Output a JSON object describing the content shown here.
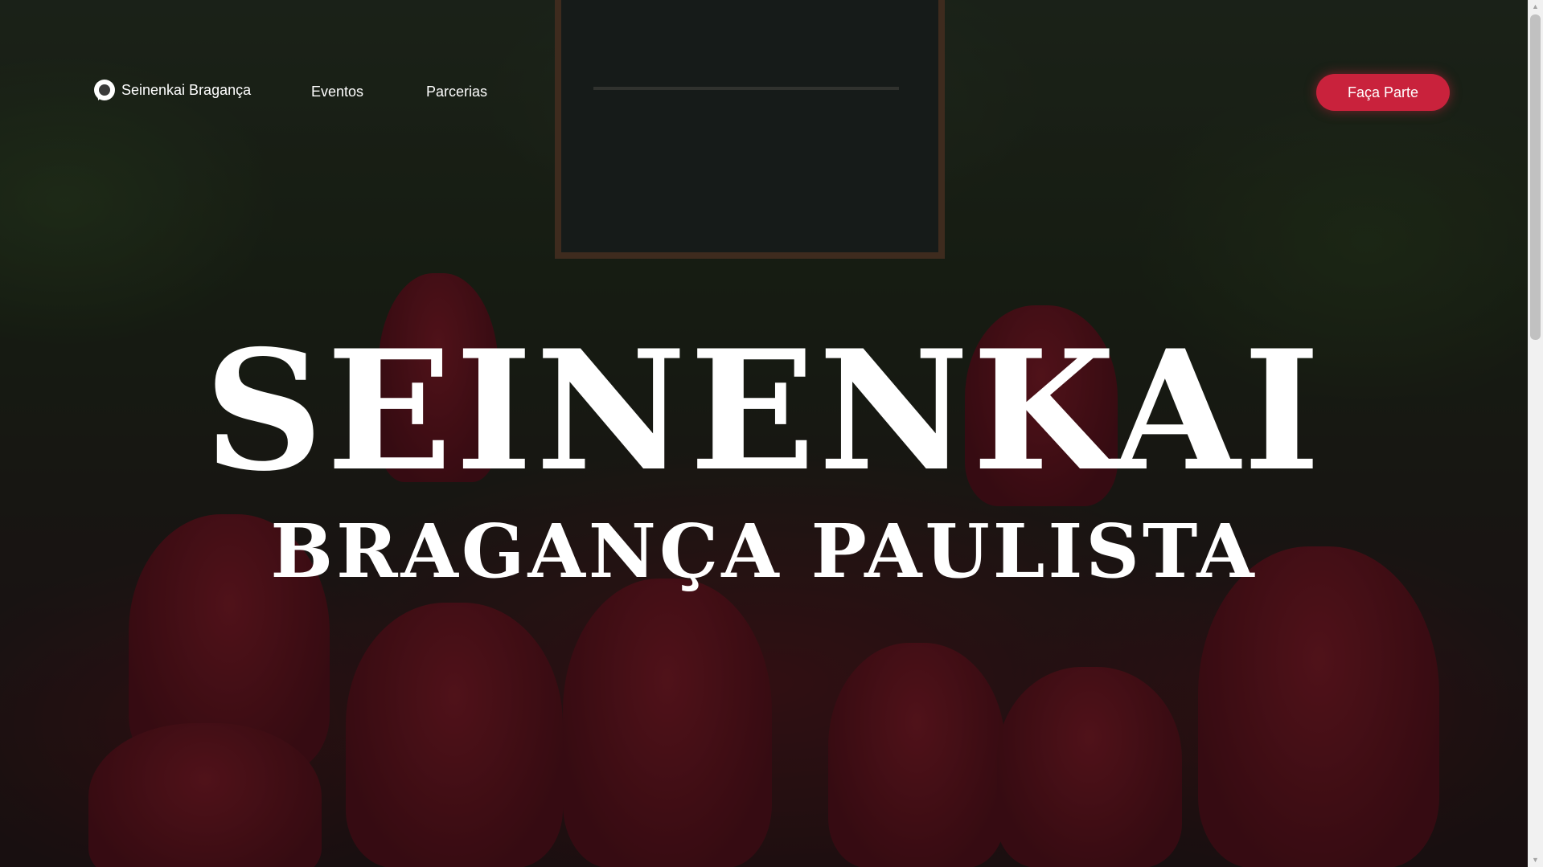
{
  "nav": {
    "brand_label": "Seinenkai Bragança",
    "links": [
      {
        "label": "Eventos"
      },
      {
        "label": "Parcerias"
      }
    ],
    "cta_label": "Faça Parte"
  },
  "hero": {
    "title": "SEINENKAI",
    "subtitle": "BRAGANÇA PAULISTA"
  },
  "scrollbar": {
    "up_arrow": "▲",
    "down_arrow": "▼"
  },
  "colors": {
    "accent": "#c9223c",
    "text": "#ffffff",
    "overlay": "rgba(0,0,0,0.42)"
  },
  "icons": {
    "brand": "chat-bubble-icon"
  }
}
